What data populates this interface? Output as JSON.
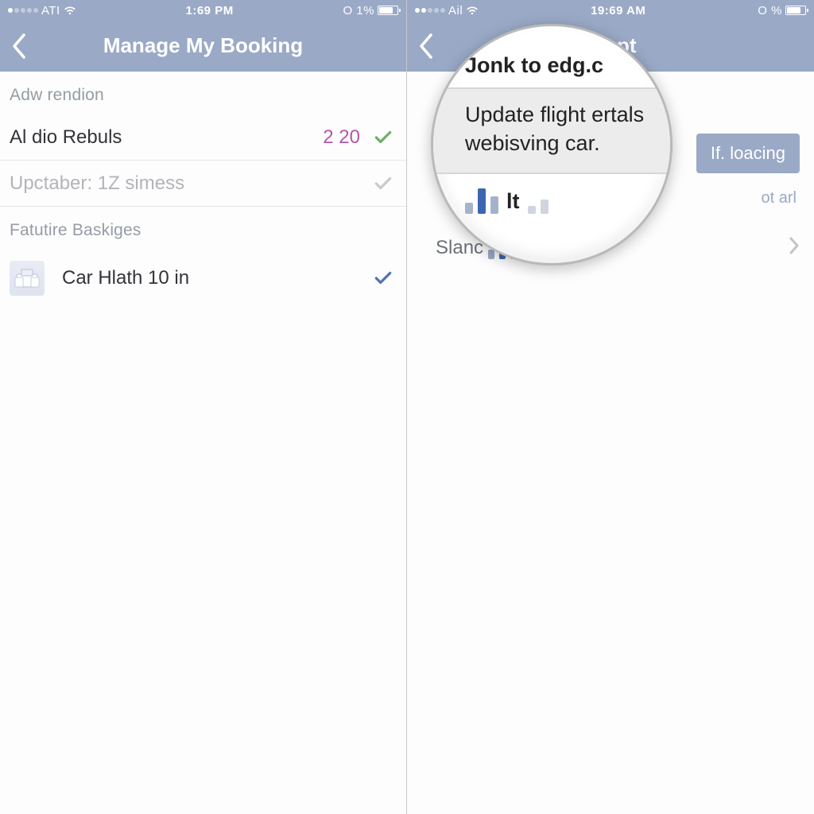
{
  "left": {
    "status": {
      "carrier": "ATI",
      "time": "1:69 PM",
      "battery": "O 1%",
      "signal_on": 1
    },
    "nav": {
      "title": "Manage My Booking"
    },
    "section1": {
      "label": "Adw rendion"
    },
    "row1": {
      "label": "Al dio Rebuls",
      "value": "2 20",
      "check_color": "#6eb06a"
    },
    "row2": {
      "label": "Upctaber: 1Z simess",
      "check_color": "#c9c9cf"
    },
    "section2": {
      "label": "Fatutire Baskiges"
    },
    "row3": {
      "label": "Car Hlath 10 in",
      "check_color": "#4f74b5"
    }
  },
  "right": {
    "status": {
      "carrier": "Ail",
      "time": "19:69 AM",
      "battery": "O %",
      "signal_on": 2
    },
    "nav": {
      "title": "Ricpt"
    },
    "button": {
      "label": "If. loacing"
    },
    "link": {
      "label": "ot arl"
    },
    "row": {
      "label": "Slanc"
    },
    "magnifier": {
      "line1": "Jonk to edg.c",
      "body": "Update flight ertals webisving car.",
      "line3": "lt"
    }
  }
}
